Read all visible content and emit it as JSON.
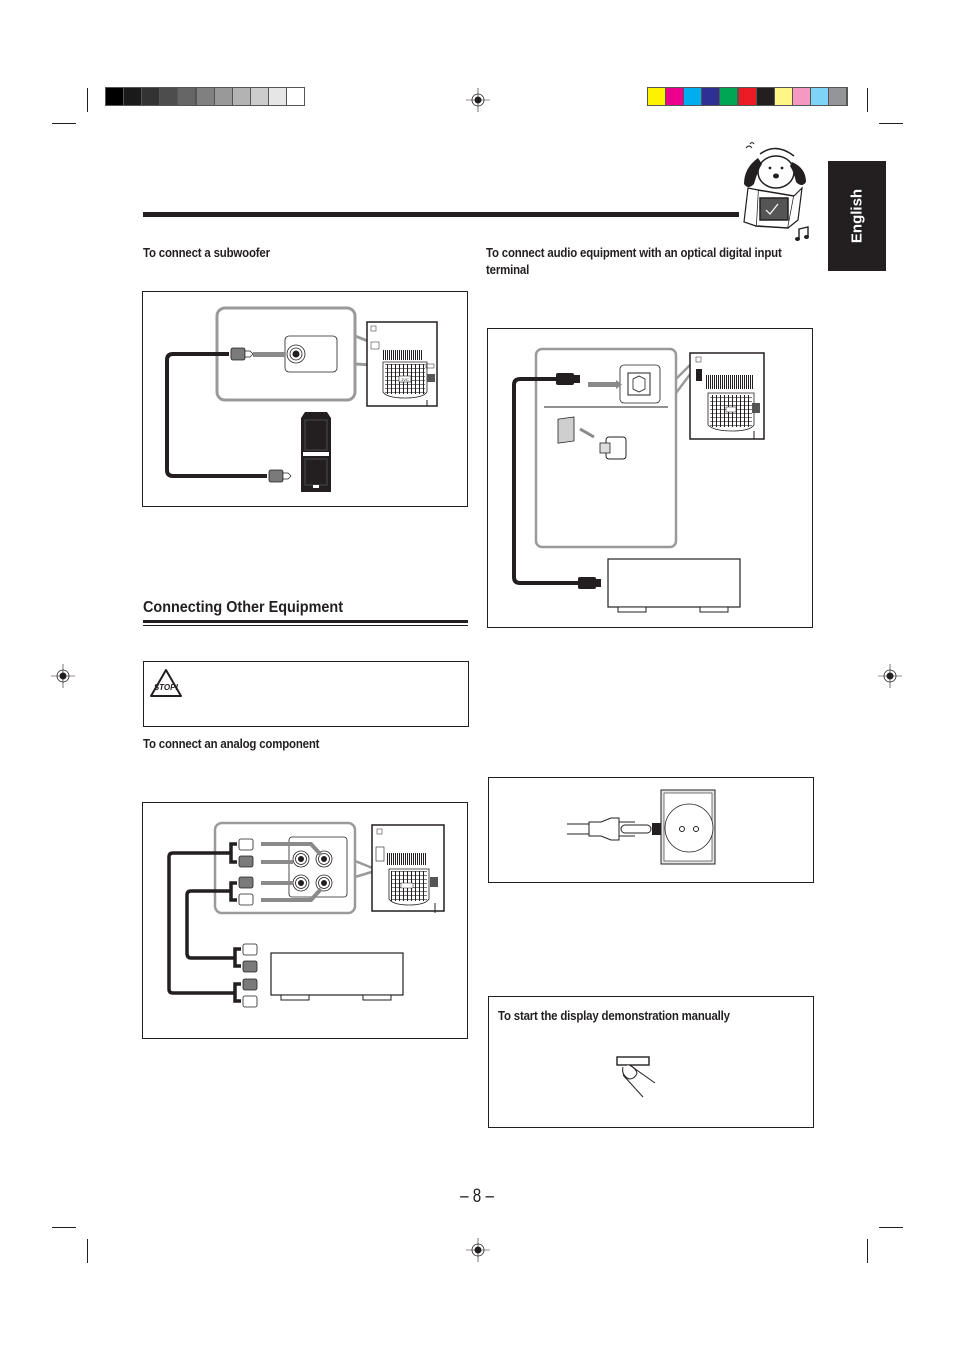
{
  "print_marks": {
    "grayscale_swatches": [
      "#000000",
      "#1a1a1a",
      "#333333",
      "#4d4d4d",
      "#666666",
      "#808080",
      "#999999",
      "#b3b3b3",
      "#cccccc",
      "#e6e6e6",
      "#ffffff"
    ],
    "color_swatches": [
      "#fff200",
      "#ec008c",
      "#00aeef",
      "#2e3192",
      "#00a651",
      "#ed1c24",
      "#231f20",
      "#fff685",
      "#f49ac1",
      "#7fd3f7",
      "#939598"
    ]
  },
  "language_tab": {
    "label": "English"
  },
  "sections": {
    "subwoofer": {
      "heading": "To connect a subwoofer"
    },
    "optical": {
      "heading": "To connect audio equipment with an optical digital input terminal"
    },
    "other_equipment": {
      "title": "Connecting Other Equipment"
    },
    "caution": {
      "icon_label": "STOP!"
    },
    "analog": {
      "heading": "To connect an analog component"
    },
    "demo": {
      "heading": "To start the display demonstration manually"
    }
  },
  "diagrams": {
    "unit_brand": "JVC"
  },
  "page_number": "– 8 –"
}
